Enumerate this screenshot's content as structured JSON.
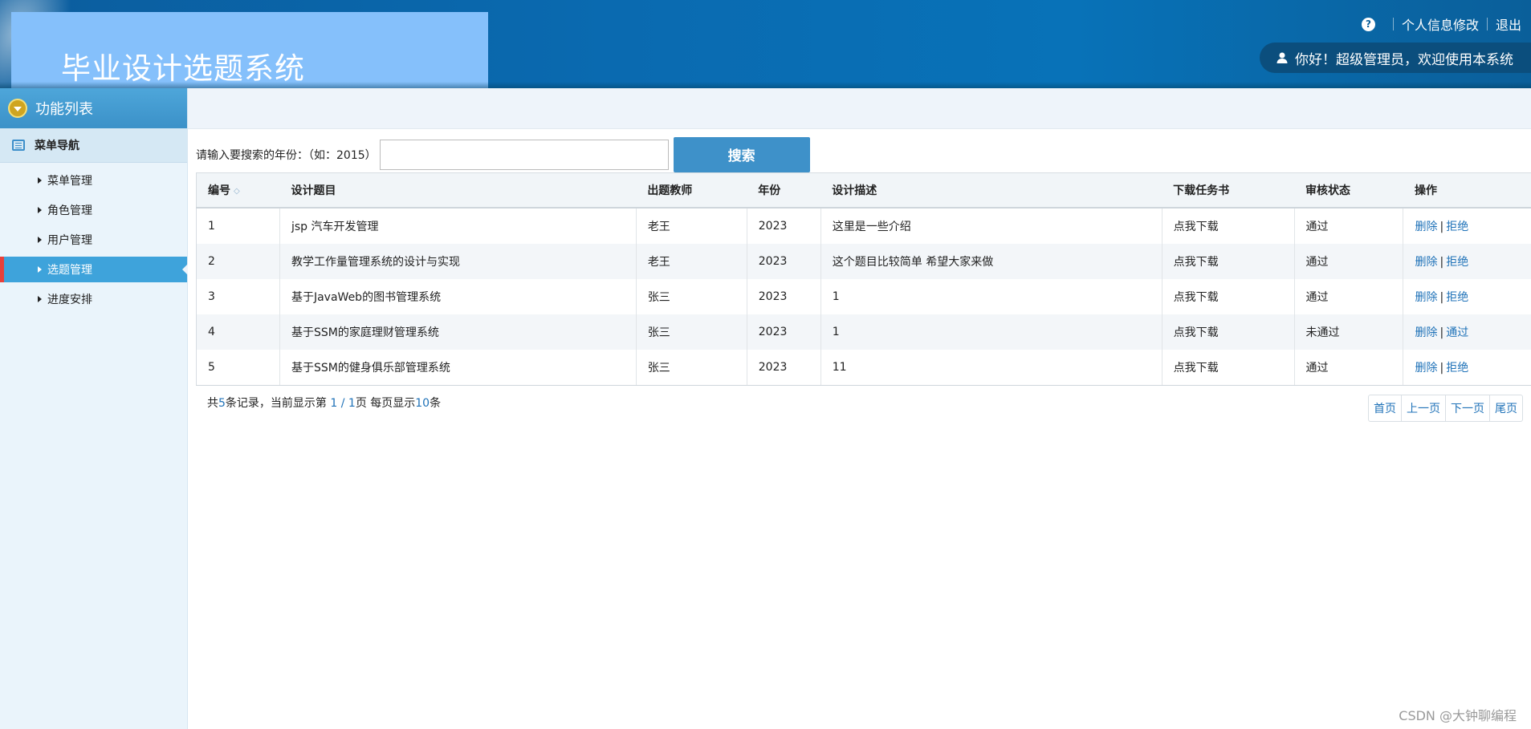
{
  "header": {
    "title": "毕业设计选题系统",
    "help_icon": "?",
    "profile_link": "个人信息修改",
    "logout_link": "退出",
    "welcome": "你好！超级管理员，欢迎使用本系统"
  },
  "sidebar": {
    "heading": "功能列表",
    "section": "菜单导航",
    "items": [
      {
        "label": "菜单管理",
        "active": false
      },
      {
        "label": "角色管理",
        "active": false
      },
      {
        "label": "用户管理",
        "active": false
      },
      {
        "label": "选题管理",
        "active": true
      },
      {
        "label": "进度安排",
        "active": false
      }
    ]
  },
  "search": {
    "label": "请输入要搜索的年份：（如：2015）",
    "value": "",
    "button": "搜索"
  },
  "table": {
    "headers": [
      "编号",
      "设计题目",
      "出题教师",
      "年份",
      "设计描述",
      "下载任务书",
      "审核状态",
      "操作"
    ],
    "rows": [
      {
        "id": "1",
        "title": "jsp 汽车开发管理",
        "teacher": "老王",
        "year": "2023",
        "desc": "这里是一些介绍",
        "download": "点我下载",
        "status": "通过",
        "status_type": "pass",
        "op1": "删除",
        "op2": "拒绝"
      },
      {
        "id": "2",
        "title": "教学工作量管理系统的设计与实现",
        "teacher": "老王",
        "year": "2023",
        "desc": "这个题目比较简单 希望大家来做",
        "download": "点我下载",
        "status": "通过",
        "status_type": "pass",
        "op1": "删除",
        "op2": "拒绝"
      },
      {
        "id": "3",
        "title": "基于JavaWeb的图书管理系统",
        "teacher": "张三",
        "year": "2023",
        "desc": "1",
        "download": "点我下载",
        "status": "通过",
        "status_type": "pass",
        "op1": "删除",
        "op2": "拒绝"
      },
      {
        "id": "4",
        "title": "基于SSM的家庭理财管理系统",
        "teacher": "张三",
        "year": "2023",
        "desc": "1",
        "download": "点我下载",
        "status": "未通过",
        "status_type": "fail",
        "op1": "删除",
        "op2": "通过"
      },
      {
        "id": "5",
        "title": "基于SSM的健身俱乐部管理系统",
        "teacher": "张三",
        "year": "2023",
        "desc": "11",
        "download": "点我下载",
        "status": "通过",
        "status_type": "pass",
        "op1": "删除",
        "op2": "拒绝"
      }
    ]
  },
  "paging": {
    "text_total_prefix": "共",
    "total": "5",
    "text_total_suffix": "条记录，当前显示第 ",
    "current": "1 / 1",
    "text_page_suffix": "页 每页显示",
    "per_page": "10",
    "text_per_page_suffix": "条",
    "first": "首页",
    "prev": "上一页",
    "next": "下一页",
    "last": "尾页"
  },
  "watermark": "CSDN @大钟聊编程",
  "colors": {
    "header_bg": "#0a6ab0",
    "title_box": "#85c0fb",
    "accent": "#3ea3db",
    "pass": "#1f9a1f",
    "fail": "#e02020",
    "link": "#1f72b8"
  }
}
